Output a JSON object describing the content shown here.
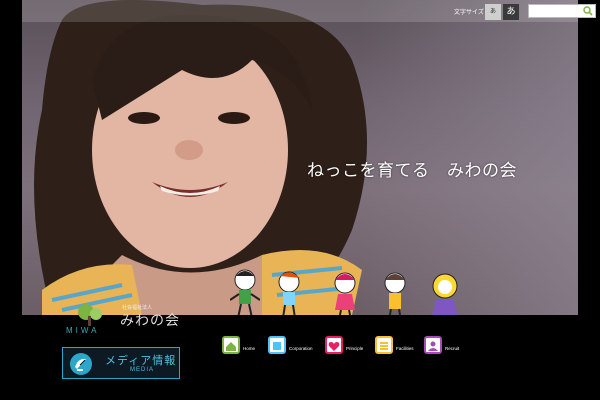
{
  "header": {
    "text_size_label": "文字サイズ",
    "size_small": "あ",
    "size_large": "あ",
    "search_placeholder": ""
  },
  "hero": {
    "tagline": "ねっこを育てる　みわの会"
  },
  "logo": {
    "small_text": "社会福祉法人",
    "name": "みわの会",
    "roman": "MIWA"
  },
  "media": {
    "label": "メディア情報",
    "sub": "MEDIA"
  },
  "nav": [
    {
      "label": "Home",
      "icon": "house-icon",
      "color": "#7cb342"
    },
    {
      "label": "Corporation",
      "icon": "info-icon",
      "color": "#4fc3f7"
    },
    {
      "label": "Principle",
      "icon": "heart-icon",
      "color": "#e91e63"
    },
    {
      "label": "Facilities",
      "icon": "list-icon",
      "color": "#fbc02d"
    },
    {
      "label": "Recruit",
      "icon": "person-icon",
      "color": "#ab47bc"
    }
  ],
  "colors": {
    "accent_blue": "#2aa7c9",
    "logo_teal": "#3fa9b8"
  }
}
